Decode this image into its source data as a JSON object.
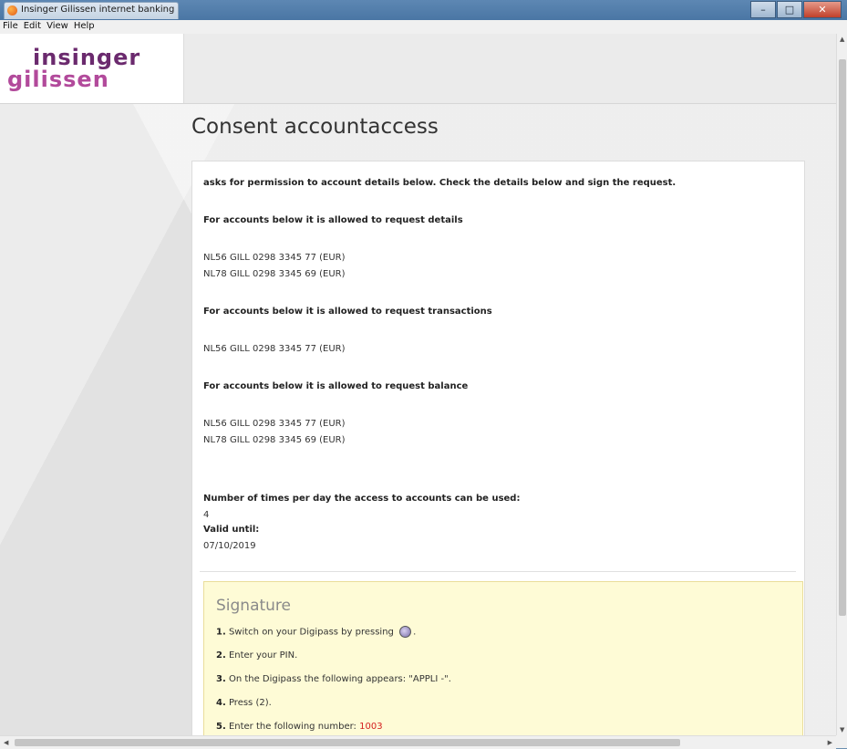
{
  "window": {
    "title": "Insinger Gilissen internet banking",
    "controls": {
      "minimize": "–",
      "maximize": "□",
      "close": "✕"
    }
  },
  "menu": [
    "File",
    "Edit",
    "View",
    "Help"
  ],
  "logo": {
    "line1": "insinger",
    "line2": "gilissen"
  },
  "page": {
    "title": "Consent accountaccess",
    "intro": "asks for permission to account details below. Check the details below and sign the request.",
    "sections": [
      {
        "heading": "For accounts below it is allowed to request details",
        "accounts": [
          "NL56 GILL 0298 3345 77 (EUR)",
          "NL78 GILL 0298 3345 69 (EUR)"
        ]
      },
      {
        "heading": "For accounts below it is allowed to request transactions",
        "accounts": [
          "NL56 GILL 0298 3345 77 (EUR)"
        ]
      },
      {
        "heading": "For accounts below it is allowed to request balance",
        "accounts": [
          "NL56 GILL 0298 3345 77 (EUR)",
          "NL78 GILL 0298 3345 69 (EUR)"
        ]
      }
    ],
    "usage_label": "Number of times per day the access to accounts can be used:",
    "usage_value": "4",
    "valid_label": "Valid until:",
    "valid_value": "07/10/2019"
  },
  "signature": {
    "title": "Signature",
    "steps": [
      {
        "num": "1.",
        "text": "Switch on your Digipass by pressing",
        "suffix": "."
      },
      {
        "num": "2.",
        "text": "Enter your PIN."
      },
      {
        "num": "3.",
        "text": "On the Digipass the following appears: \"APPLI -\"."
      },
      {
        "num": "4.",
        "text": "Press (2)."
      },
      {
        "num": "5.",
        "text": "Enter the following number:",
        "value": "1003"
      }
    ]
  },
  "colors": {
    "accent_red": "#d42020",
    "signature_bg": "#fefbd6",
    "logo_purple": "#6b2a6e",
    "logo_pink": "#b24a9b"
  }
}
